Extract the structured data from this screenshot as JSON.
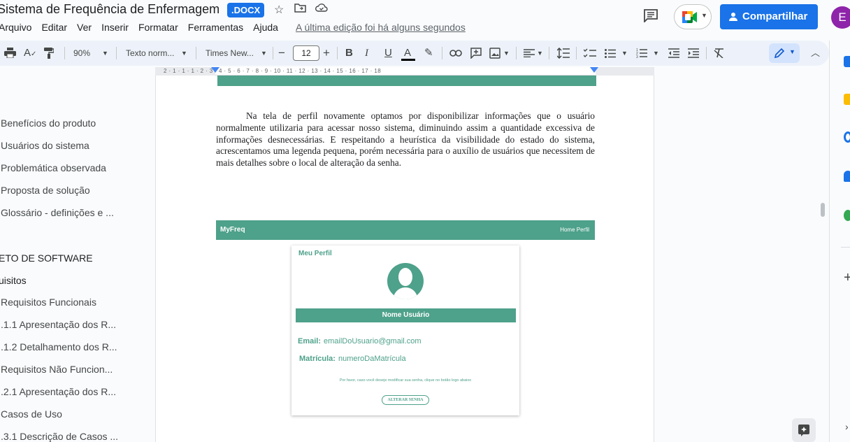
{
  "header": {
    "title": "Sistema de Frequência de Enfermagem",
    "badge": ".DOCX",
    "menus": [
      "Arquivo",
      "Editar",
      "Ver",
      "Inserir",
      "Formatar",
      "Ferramentas",
      "Ajuda"
    ],
    "last_edit": "A última edição foi há alguns segundos",
    "share_label": "Compartilhar",
    "avatar_initial": "E"
  },
  "toolbar": {
    "zoom": "90%",
    "style": "Texto norm...",
    "font": "Times New...",
    "font_size": "12",
    "minus": "−",
    "plus": "+",
    "bold": "B",
    "italic": "I",
    "underline": "U",
    "text_color": "A"
  },
  "ruler": {
    "marks": "2 · 1 · 1 · 1 · 2 · 3 · 4 · 5 · 6 · 7 · 8 · 9 · 10 · 11 · 12 · 13 · 14 · 15 · 16 · 17 · 18"
  },
  "outline": {
    "items": [
      {
        "label": "Benefícios do produto",
        "type": "item"
      },
      {
        "label": "Usuários do sistema",
        "type": "item"
      },
      {
        "label": "Problemática observada",
        "type": "item"
      },
      {
        "label": "Proposta de solução",
        "type": "item"
      },
      {
        "label": "Glossário - definições e ...",
        "type": "item"
      },
      {
        "label": "ETO DE SOFTWARE",
        "type": "heading"
      },
      {
        "label": "uisitos",
        "type": "heading"
      },
      {
        "label": "Requisitos Funcionais",
        "type": "item"
      },
      {
        "label": ".1.1 Apresentação dos R...",
        "type": "item"
      },
      {
        "label": ".1.2 Detalhamento dos R...",
        "type": "item"
      },
      {
        "label": "Requisitos Não Funcion...",
        "type": "item"
      },
      {
        "label": ".2.1 Apresentação dos R...",
        "type": "item"
      },
      {
        "label": "Casos de Uso",
        "type": "item"
      },
      {
        "label": ".3.1 Descrição de Casos ...",
        "type": "item"
      }
    ]
  },
  "document": {
    "paragraph": "Na tela de perfil novamente optamos por disponibilizar informações que o usuário normalmente utilizaria para acessar nosso sistema, diminuindo assim a quantidade excessiva de informações desnecessárias. E respeitando a heurística da visibilidade do estado do sistema, acrescentamos uma legenda pequena, porém necessária para o auxílio de usuários que necessitem de mais detalhes sobre o local de alteração da senha.",
    "mockup": {
      "brand": "MyFreq",
      "nav_links": "Home  Perfil",
      "card_title": "Meu Perfil",
      "name_bar": "Nome Usuário",
      "email_label": "Email:",
      "email_value": "emailDoUsuario@gmail.com",
      "matricula_label": "Matrícula:",
      "matricula_value": "numeroDaMatrícula",
      "hint": "Por favor, caso você deseje modificar sua senha, clique no botão logo abaixo",
      "button": "ALTERAR SENHA"
    }
  },
  "colors": {
    "accent": "#1a73e8",
    "mock_green": "#4ea18a"
  }
}
